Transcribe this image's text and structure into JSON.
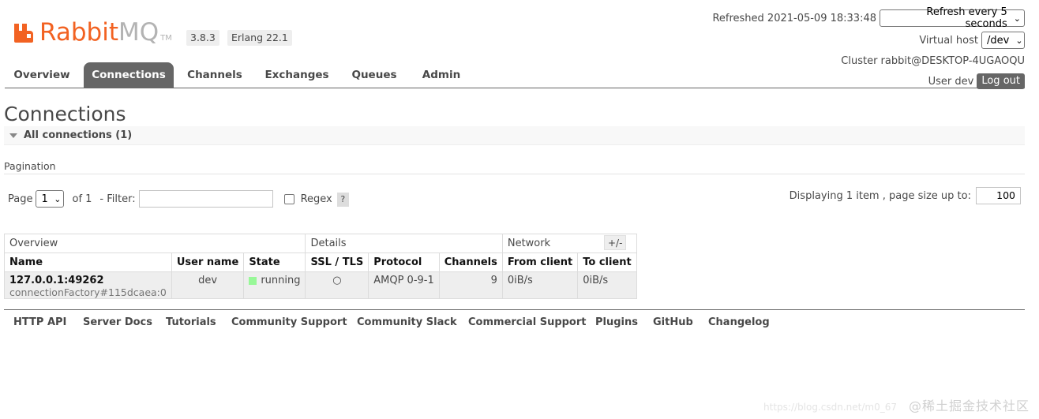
{
  "header": {
    "logo_primary": "Rabbit",
    "logo_secondary": "MQ",
    "logo_tm": "TM",
    "version": "3.8.3",
    "erlang": "Erlang 22.1",
    "refreshed_text": "Refreshed 2021-05-09 18:33:48",
    "refresh_select": "Refresh every 5 seconds",
    "virtual_host_label": "Virtual host",
    "virtual_host_value": "/dev",
    "cluster_text": "Cluster rabbit@DESKTOP-4UGAOQU",
    "user_text": "User dev",
    "logout_label": "Log out"
  },
  "tabs": [
    {
      "label": "Overview",
      "active": false
    },
    {
      "label": "Connections",
      "active": true
    },
    {
      "label": "Channels",
      "active": false
    },
    {
      "label": "Exchanges",
      "active": false
    },
    {
      "label": "Queues",
      "active": false
    },
    {
      "label": "Admin",
      "active": false
    }
  ],
  "main": {
    "title": "Connections",
    "section_label": "All connections (1)",
    "pagination_label": "Pagination",
    "page_label": "Page",
    "page_value": "1",
    "of_label": "of 1",
    "filter_label": "- Filter:",
    "filter_value": "",
    "regex_label": "Regex",
    "help_label": "?",
    "display_text": "Displaying 1 item , page size up to:",
    "page_size": "100"
  },
  "table": {
    "groups": [
      "Overview",
      "Details",
      "Network"
    ],
    "columns": [
      "Name",
      "User name",
      "State",
      "SSL / TLS",
      "Protocol",
      "Channels",
      "From client",
      "To client"
    ],
    "rows": [
      {
        "name": "127.0.0.1:49262",
        "sub": "connectionFactory#115dcaea:0",
        "user": "dev",
        "state": "running",
        "ssl": "○",
        "protocol": "AMQP 0-9-1",
        "channels": "9",
        "from_client": "0iB/s",
        "to_client": "0iB/s"
      }
    ],
    "toggle_label": "+/-"
  },
  "footer": {
    "links": [
      "HTTP API",
      "Server Docs",
      "Tutorials",
      "Community Support",
      "Community Slack",
      "Commercial Support",
      "Plugins",
      "GitHub",
      "Changelog"
    ]
  },
  "watermark": {
    "text": "@稀土掘金技术社区",
    "url": "https://blog.csdn.net/m0_67"
  },
  "colors": {
    "brand_orange": "#f26222",
    "tab_active": "#666666",
    "running": "#98f898"
  }
}
